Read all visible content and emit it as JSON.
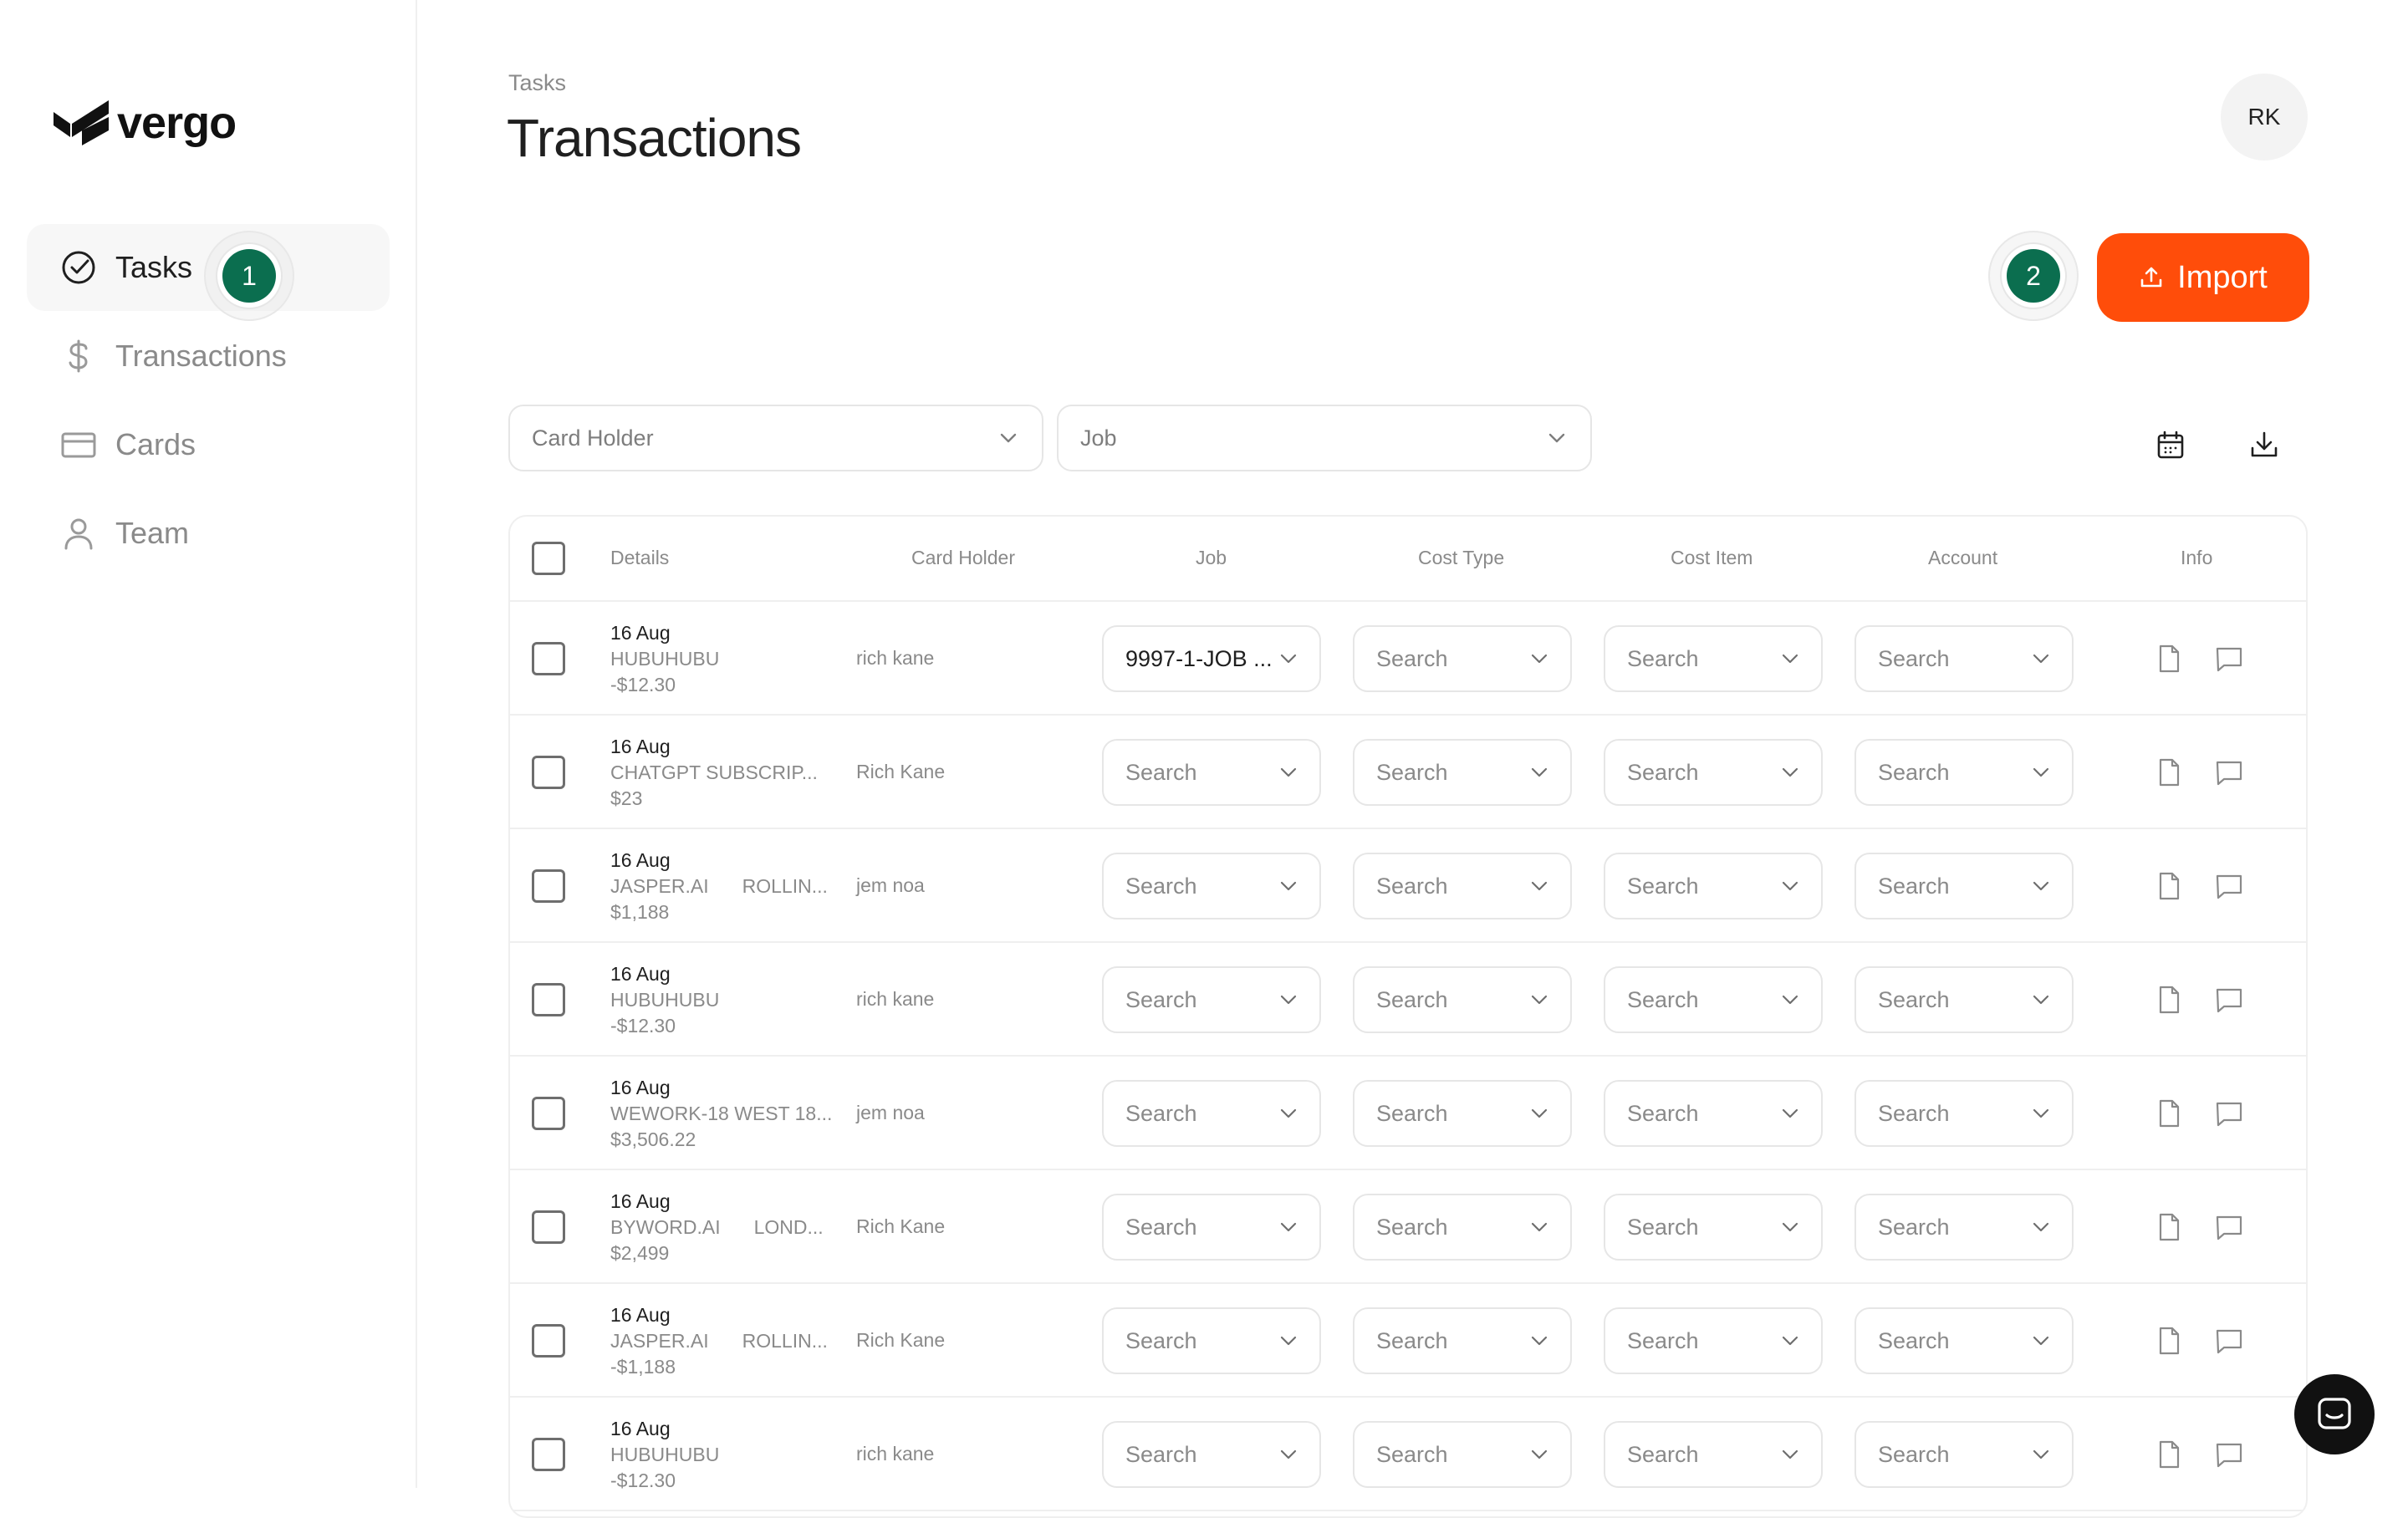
{
  "app": {
    "logo_text": "vergo",
    "brand_color": "#111111",
    "accent_color": "#ff4d0a",
    "step_color": "#0b6e4f"
  },
  "sidebar": {
    "items": [
      {
        "label": "Tasks",
        "icon": "check-circle-icon",
        "active": true
      },
      {
        "label": "Transactions",
        "icon": "dollar-icon",
        "active": false
      },
      {
        "label": "Cards",
        "icon": "credit-card-icon",
        "active": false
      },
      {
        "label": "Team",
        "icon": "user-icon",
        "active": false
      }
    ],
    "step_badge": "1"
  },
  "header": {
    "breadcrumb": "Tasks",
    "title": "Transactions",
    "avatar_initials": "RK",
    "step_badge": "2",
    "import_label": "Import"
  },
  "filters": {
    "card_holder_placeholder": "Card Holder",
    "job_placeholder": "Job",
    "calendar_icon": "calendar-icon",
    "download_icon": "download-icon"
  },
  "table": {
    "columns": [
      "Details",
      "Card Holder",
      "Job",
      "Cost Type",
      "Cost Item",
      "Account",
      "Info"
    ],
    "rows": [
      {
        "date": "16 Aug",
        "merchant": "HUBUHUBU",
        "merchant_extra": "",
        "amount": "-$12.30",
        "card_holder": "rich kane",
        "job": "9997-1-JOB ...",
        "cost_type": "Search",
        "cost_item": "Search",
        "account": "Search"
      },
      {
        "date": "16 Aug",
        "merchant": "CHATGPT SUBSCRIP...",
        "merchant_extra": "",
        "amount": "$23",
        "card_holder": "Rich Kane",
        "job": "Search",
        "cost_type": "Search",
        "cost_item": "Search",
        "account": "Search"
      },
      {
        "date": "16 Aug",
        "merchant": "JASPER.AI",
        "merchant_extra": "ROLLIN...",
        "amount": "$1,188",
        "card_holder": "jem noa",
        "job": "Search",
        "cost_type": "Search",
        "cost_item": "Search",
        "account": "Search"
      },
      {
        "date": "16 Aug",
        "merchant": "HUBUHUBU",
        "merchant_extra": "",
        "amount": "-$12.30",
        "card_holder": "rich kane",
        "job": "Search",
        "cost_type": "Search",
        "cost_item": "Search",
        "account": "Search"
      },
      {
        "date": "16 Aug",
        "merchant": "WEWORK-18 WEST 18...",
        "merchant_extra": "",
        "amount": "$3,506.22",
        "card_holder": "jem noa",
        "job": "Search",
        "cost_type": "Search",
        "cost_item": "Search",
        "account": "Search"
      },
      {
        "date": "16 Aug",
        "merchant": "BYWORD.AI",
        "merchant_extra": "LOND...",
        "amount": "$2,499",
        "card_holder": "Rich Kane",
        "job": "Search",
        "cost_type": "Search",
        "cost_item": "Search",
        "account": "Search"
      },
      {
        "date": "16 Aug",
        "merchant": "JASPER.AI",
        "merchant_extra": "ROLLIN...",
        "amount": "-$1,188",
        "card_holder": "Rich Kane",
        "job": "Search",
        "cost_type": "Search",
        "cost_item": "Search",
        "account": "Search"
      },
      {
        "date": "16 Aug",
        "merchant": "HUBUHUBU",
        "merchant_extra": "",
        "amount": "-$12.30",
        "card_holder": "rich kane",
        "job": "Search",
        "cost_type": "Search",
        "cost_item": "Search",
        "account": "Search"
      }
    ]
  },
  "chat_launcher_icon": "chat-icon"
}
